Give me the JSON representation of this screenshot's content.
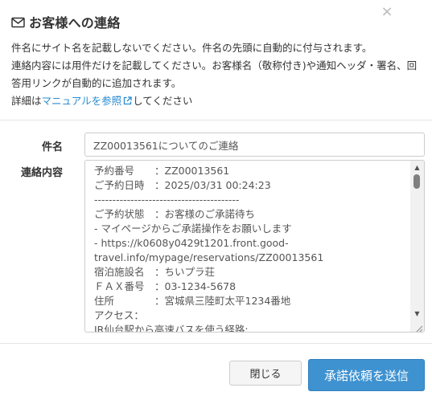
{
  "dialog": {
    "title": "お客様への連絡",
    "close_symbol": "×"
  },
  "description": {
    "line1": "件名にサイト名を記載しないでください。件名の先頭に自動的に付与されます。",
    "line2": "連絡内容には用件だけを記載してください。お客様名（敬称付き)や通知ヘッダ・署名、回",
    "line3": "答用リンクが自動的に追加されます。",
    "line4_prefix": "詳細は",
    "manual_link": "マニュアルを参照",
    "line4_suffix": "してください"
  },
  "form": {
    "subject_label": "件名",
    "subject_value": "ZZ00013561についてのご連絡",
    "content_label": "連絡内容",
    "content_lines": [
      "予約番号　　：ZZ00013561",
      "ご予約日時　：2025/03/31 00:24:23",
      "----------------------------------------",
      "ご予約状態　：お客様のご承諾待ち",
      "- マイページからご承諾操作をお願いします",
      "- https://k0608y0429t1201.front.good-",
      "travel.info/mypage/reservations/ZZ00013561",
      "宿泊施設名　：ちいプラ荘",
      "ＦＡＸ番号　：03-1234-5678",
      "住所　　　　：宮城県三陸町太平1234番地",
      "アクセス：",
      "JR仙台駅から高速バスを使う経路:"
    ]
  },
  "footer": {
    "close_label": "閉じる",
    "submit_label": "承諾依頼を送信"
  },
  "colors": {
    "primary": "#3f92d0",
    "link": "#2a8cd0"
  },
  "icons": {
    "title": "mail-icon",
    "link": "external-link-icon",
    "close": "close-icon"
  }
}
